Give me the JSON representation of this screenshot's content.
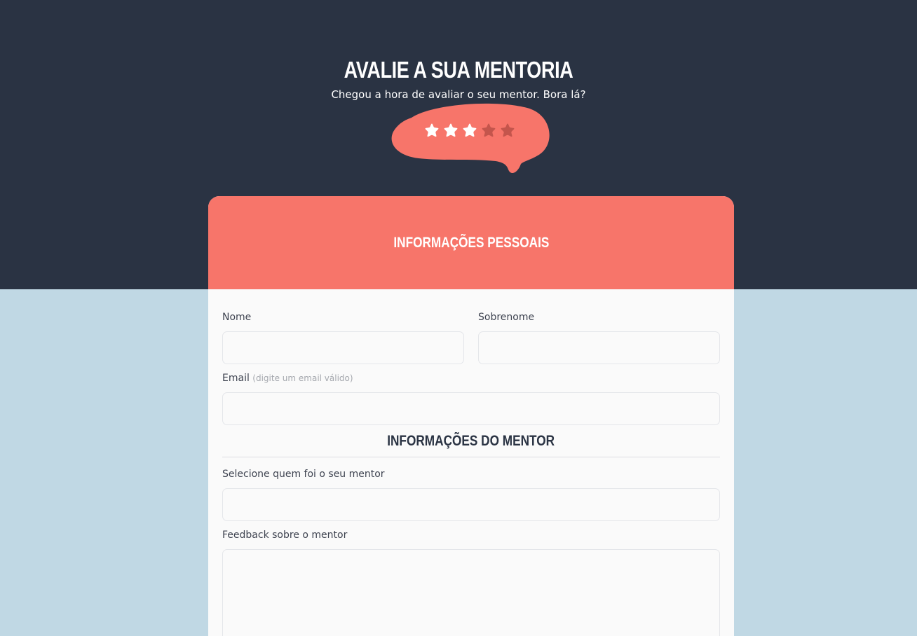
{
  "header": {
    "title": "AVALIE A SUA MENTORIA",
    "subtitle": "Chegou a hora de avaliar o seu mentor. Bora lá?"
  },
  "rating": {
    "value": 3,
    "max": 5,
    "icon": "star-icon"
  },
  "colors": {
    "dark_band": "#2a3343",
    "accent": "#f7756a",
    "background": "#c0d8e4",
    "star_active": "#ffffff",
    "star_inactive": "#c4554c"
  },
  "personal": {
    "title": "INFORMAÇÕES PESSOAIS",
    "first_name_label": "Nome",
    "last_name_label": "Sobrenome",
    "email_label": "Email",
    "email_hint": "(digite um email válido)"
  },
  "mentor": {
    "title": "INFORMAÇÕES DO MENTOR",
    "select_label": "Selecione quem foi o seu mentor",
    "feedback_label": "Feedback sobre o mentor"
  }
}
